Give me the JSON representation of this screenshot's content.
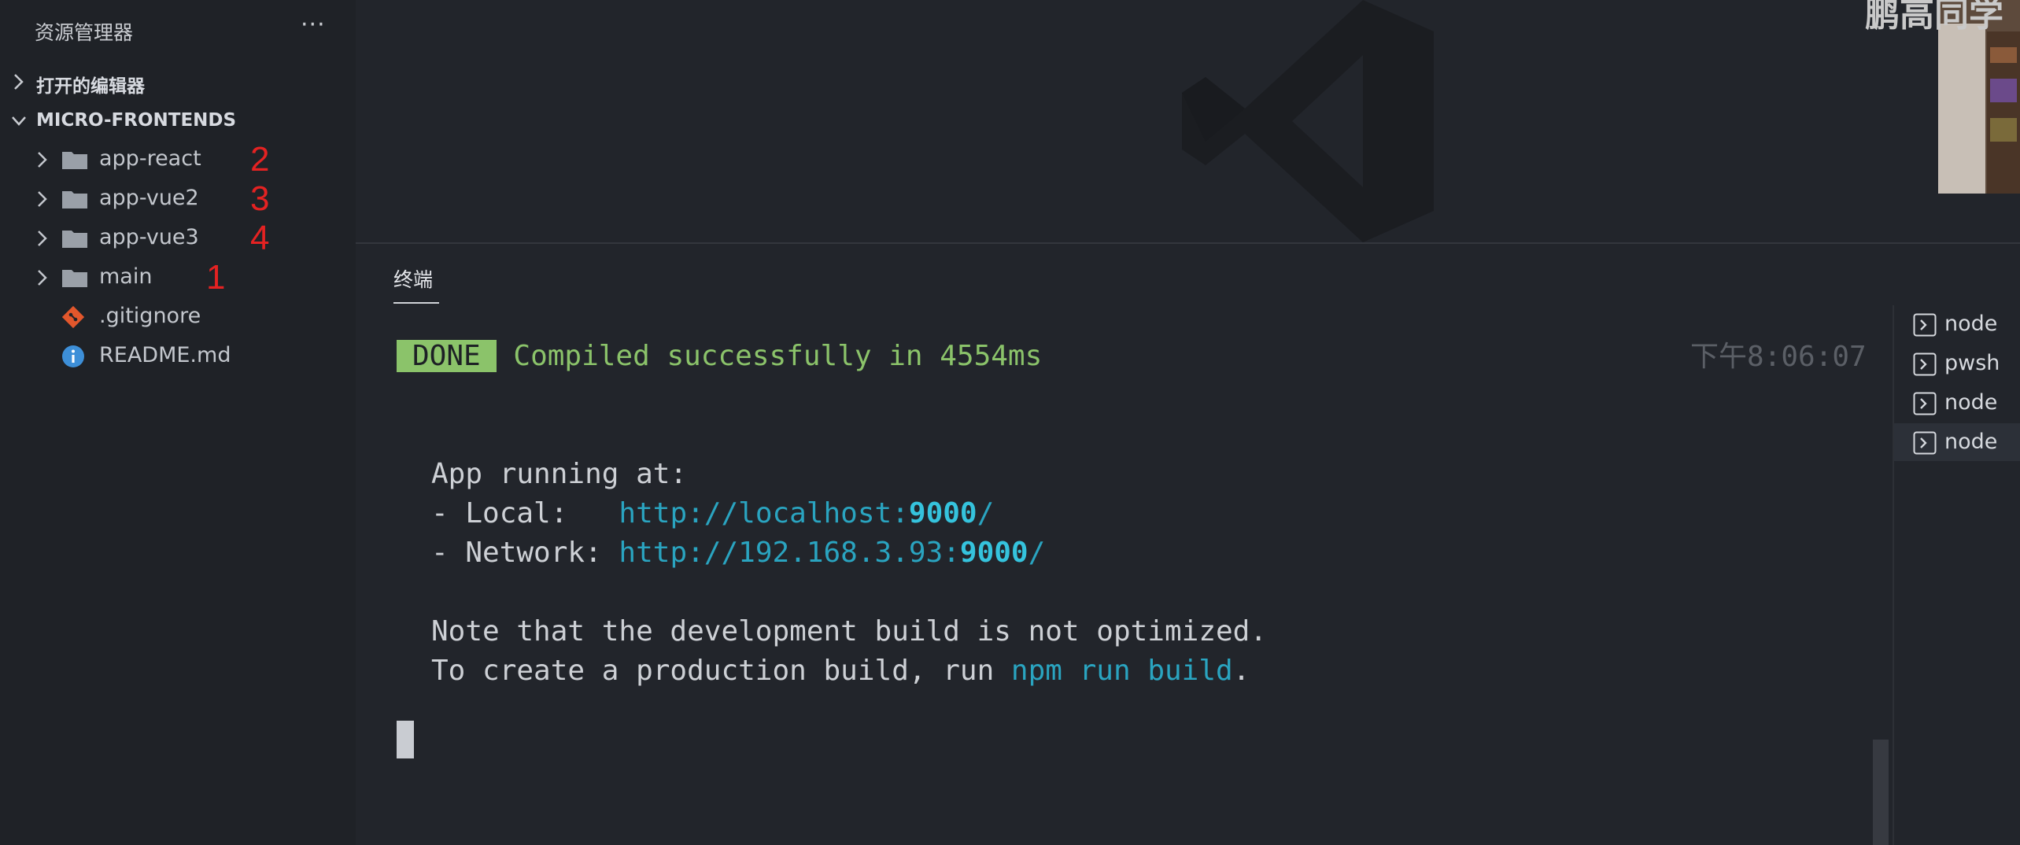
{
  "sidebar": {
    "title": "资源管理器",
    "more_label": "···",
    "open_editors_label": "打开的编辑器",
    "project_label": "MICRO-FRONTENDS",
    "items": [
      {
        "label": "app-react",
        "type": "folder",
        "annotation": "2"
      },
      {
        "label": "app-vue2",
        "type": "folder",
        "annotation": "3"
      },
      {
        "label": "app-vue3",
        "type": "folder",
        "annotation": "4"
      },
      {
        "label": "main",
        "type": "folder",
        "annotation": "1"
      },
      {
        "label": ".gitignore",
        "type": "git-file"
      },
      {
        "label": "README.md",
        "type": "info-file"
      }
    ]
  },
  "overlay": {
    "channel_name": "鹏高同学"
  },
  "panel": {
    "tab_label": "终端",
    "terminal": {
      "done_badge": "DONE",
      "compiled_message": "Compiled successfully in 4554ms",
      "timestamp": "下午8:06:07",
      "app_running": "App running at:",
      "local_label": "- Local:   ",
      "local_url_prefix": "http://localhost:",
      "local_port": "9000",
      "local_url_suffix": "/",
      "network_label": "- Network: ",
      "network_url_prefix": "http://192.168.3.93:",
      "network_port": "9000",
      "network_url_suffix": "/",
      "note_line": "Note that the development build is not optimized.",
      "build_line_prefix": "To create a production build, run ",
      "build_command": "npm run build",
      "build_line_suffix": "."
    },
    "terminals": [
      {
        "label": "node"
      },
      {
        "label": "pwsh"
      },
      {
        "label": "node"
      },
      {
        "label": "node",
        "active": true
      }
    ]
  },
  "colors": {
    "success_green": "#8bc36a",
    "link_cyan": "#2aa4c0",
    "annotation_red": "#e42222"
  }
}
